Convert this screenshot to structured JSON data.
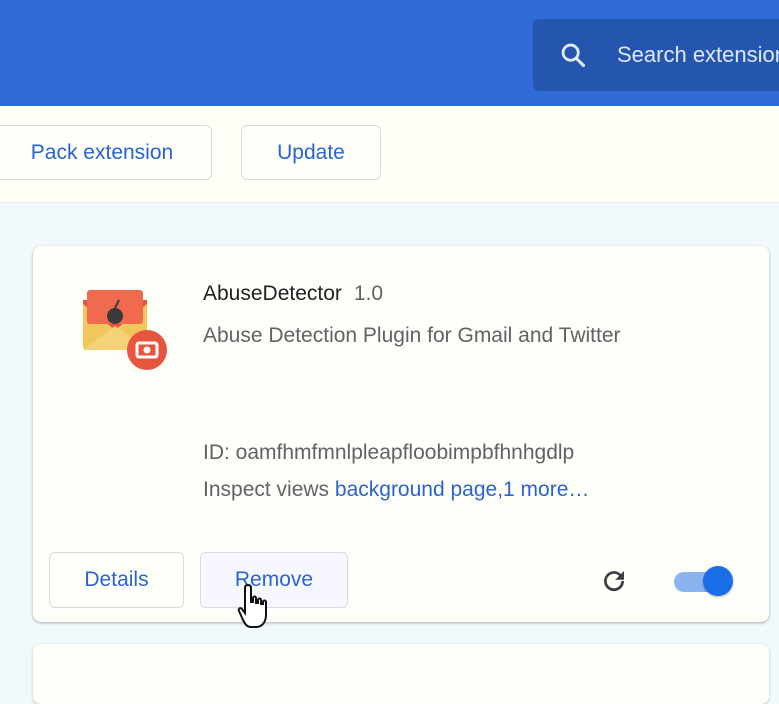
{
  "header": {
    "search_placeholder": "Search extensions",
    "search_icon": "search-icon",
    "colors": {
      "bar": "#2e6bd6",
      "search_bg": "#2456b0"
    }
  },
  "toolbar": {
    "pack_label": "Pack extension",
    "update_label": "Update"
  },
  "extension": {
    "name": "AbuseDetector",
    "version": "1.0",
    "description": "Abuse Detection Plugin for Gmail and Twitter",
    "id_text": "ID: oamfhmfmnlpleapfloobimpbfhnhgdlp",
    "inspect_prefix": "Inspect views",
    "inspect_link": "background page,1 more…",
    "details_label": "Details",
    "remove_label": "Remove",
    "enabled": true,
    "icon": "envelope-bomb-icon"
  },
  "accent": "#2a63cf"
}
